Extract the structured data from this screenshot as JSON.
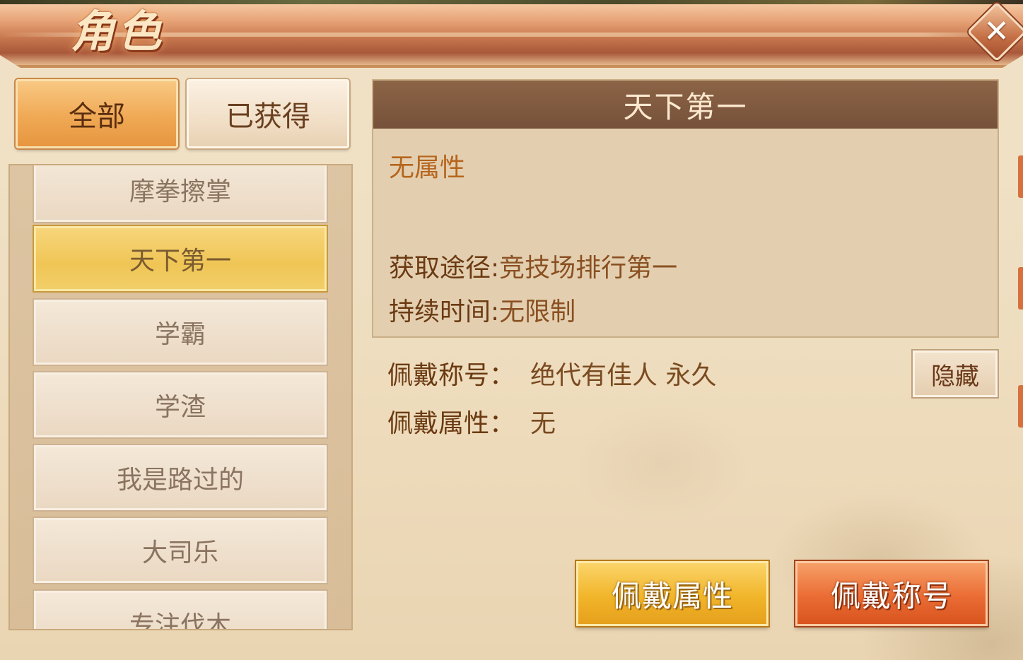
{
  "window": {
    "title": "角色",
    "close_icon": "close-icon"
  },
  "filter_tabs": {
    "all": "全部",
    "owned": "已获得"
  },
  "title_list": [
    {
      "label": "摩拳擦掌",
      "selected": false
    },
    {
      "label": "天下第一",
      "selected": true
    },
    {
      "label": "学霸",
      "selected": false
    },
    {
      "label": "学渣",
      "selected": false
    },
    {
      "label": "我是路过的",
      "selected": false
    },
    {
      "label": "大司乐",
      "selected": false
    },
    {
      "label": "专注伐木",
      "selected": false
    }
  ],
  "detail": {
    "name": "天下第一",
    "attribute": "无属性",
    "source_label": "获取途径:",
    "source_value": "竞技场排行第一",
    "duration_label": "持续时间:",
    "duration_value": "无限制"
  },
  "wearing": {
    "title_label": "佩戴称号：",
    "title_value": "绝代有佳人 永久",
    "attr_label": "佩戴属性：",
    "attr_value": "无",
    "hide_button": "隐藏"
  },
  "actions": {
    "wear_attribute": "佩戴属性",
    "wear_title": "佩戴称号"
  },
  "colors": {
    "header": "#c8784e",
    "selected_item": "#efc555",
    "primary_button": "#ea6c34",
    "secondary_button": "#f1b52a"
  }
}
